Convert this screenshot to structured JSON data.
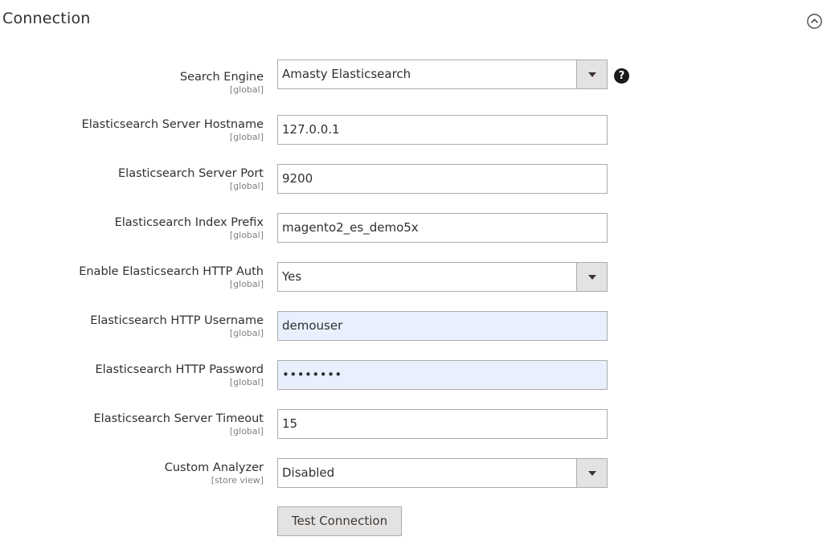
{
  "section": {
    "title": "Connection"
  },
  "fields": [
    {
      "label": "Search Engine",
      "scope": "[global]",
      "value": "Amasty Elasticsearch"
    },
    {
      "label": "Elasticsearch Server Hostname",
      "scope": "[global]",
      "value": "127.0.0.1"
    },
    {
      "label": "Elasticsearch Server Port",
      "scope": "[global]",
      "value": "9200"
    },
    {
      "label": "Elasticsearch Index Prefix",
      "scope": "[global]",
      "value": "magento2_es_demo5x"
    },
    {
      "label": "Enable Elasticsearch HTTP Auth",
      "scope": "[global]",
      "value": "Yes"
    },
    {
      "label": "Elasticsearch HTTP Username",
      "scope": "[global]",
      "value": "demouser"
    },
    {
      "label": "Elasticsearch HTTP Password",
      "scope": "[global]",
      "value": "••••••••"
    },
    {
      "label": "Elasticsearch Server Timeout",
      "scope": "[global]",
      "value": "15"
    },
    {
      "label": "Custom Analyzer",
      "scope": "[store view]",
      "value": "Disabled"
    }
  ],
  "help_icon": {
    "glyph": "?"
  },
  "test_button": {
    "label": "Test Connection"
  },
  "colors": {
    "text": "#303030",
    "scope_text": "#808080",
    "border": "#adadad",
    "autofill_bg": "#e8f0fe",
    "button_bg": "#e3e3e3"
  },
  "icons": {
    "collapse": "chevron-up-circle-icon",
    "select_arrow": "triangle-down-icon",
    "help": "question-circle-icon"
  }
}
